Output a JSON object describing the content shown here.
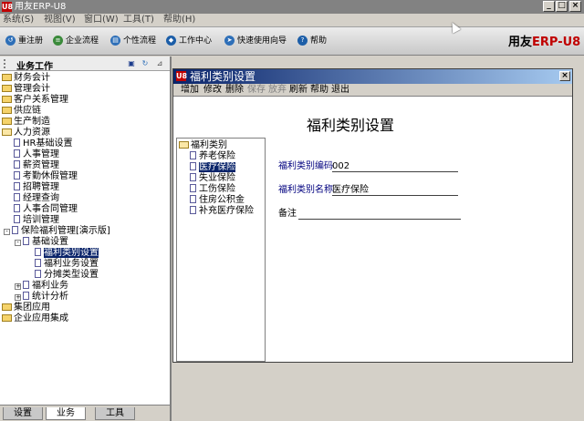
{
  "window": {
    "title": "用友ERP-U8",
    "logo_text": "U8",
    "buttons": {
      "minimize": "_",
      "maximize": "□",
      "close": "×"
    }
  },
  "menubar": {
    "items": [
      "系统(S)",
      "视图(V)",
      "窗口(W)",
      "工具(T)",
      "帮助(H)"
    ]
  },
  "toolbar": {
    "items": [
      {
        "label": "重注册",
        "icon": "re-register-icon"
      },
      {
        "label": "企业流程",
        "icon": "enterprise-flow-icon"
      },
      {
        "label": "个性流程",
        "icon": "personal-flow-icon"
      },
      {
        "label": "工作中心",
        "icon": "work-center-icon"
      },
      {
        "label": "快速使用向导",
        "icon": "quick-guide-icon"
      },
      {
        "label": "帮助",
        "icon": "help-icon"
      }
    ],
    "brand": {
      "cn": "用友",
      "en": "ERP-U8"
    }
  },
  "leftpane": {
    "title": "业务工作",
    "tree": [
      {
        "label": "财务会计",
        "kind": "folder",
        "level": 0
      },
      {
        "label": "管理会计",
        "kind": "folder",
        "level": 0
      },
      {
        "label": "客户关系管理",
        "kind": "folder",
        "level": 0
      },
      {
        "label": "供应链",
        "kind": "folder",
        "level": 0
      },
      {
        "label": "生产制造",
        "kind": "folder",
        "level": 0
      },
      {
        "label": "人力资源",
        "kind": "folder",
        "level": 0
      },
      {
        "label": "HR基础设置",
        "kind": "doc",
        "level": 1
      },
      {
        "label": "人事管理",
        "kind": "doc",
        "level": 1
      },
      {
        "label": "薪资管理",
        "kind": "doc",
        "level": 1
      },
      {
        "label": "考勤休假管理",
        "kind": "doc",
        "level": 1
      },
      {
        "label": "招聘管理",
        "kind": "doc",
        "level": 1
      },
      {
        "label": "经理查询",
        "kind": "doc",
        "level": 1
      },
      {
        "label": "人事合同管理",
        "kind": "doc",
        "level": 1
      },
      {
        "label": "培训管理",
        "kind": "doc",
        "level": 1
      },
      {
        "label": "保险福利管理[演示版]",
        "kind": "doc",
        "level": 1,
        "expander": "-"
      },
      {
        "label": "基础设置",
        "kind": "doc",
        "level": 2,
        "expander": "-"
      },
      {
        "label": "福利类别设置",
        "kind": "doc",
        "level": 3,
        "selected": true
      },
      {
        "label": "福利业务设置",
        "kind": "doc",
        "level": 3
      },
      {
        "label": "分摊类型设置",
        "kind": "doc",
        "level": 3
      },
      {
        "label": "福利业务",
        "kind": "doc",
        "level": 2,
        "expander": "+"
      },
      {
        "label": "统计分析",
        "kind": "doc",
        "level": 2,
        "expander": "+"
      },
      {
        "label": "集团应用",
        "kind": "folder",
        "level": 0
      },
      {
        "label": "企业应用集成",
        "kind": "folder",
        "level": 0
      }
    ],
    "tabs": [
      {
        "label": "设置",
        "active": false
      },
      {
        "label": "业务",
        "active": true
      },
      {
        "label": "工具",
        "active": false
      }
    ]
  },
  "child_window": {
    "title": "福利类别设置",
    "logo_text": "U8",
    "close": "×",
    "actions": [
      {
        "label": "增加",
        "enabled": true
      },
      {
        "label": "修改",
        "enabled": true
      },
      {
        "label": "删除",
        "enabled": true
      },
      {
        "label": "保存",
        "enabled": false
      },
      {
        "label": "放弃",
        "enabled": false
      },
      {
        "label": "刷新",
        "enabled": true
      },
      {
        "label": "帮助",
        "enabled": true
      },
      {
        "label": "退出",
        "enabled": true
      }
    ],
    "heading": "福利类别设置",
    "category_tree": {
      "root": "福利类别",
      "items": [
        {
          "label": "养老保险",
          "selected": false
        },
        {
          "label": "医疗保险",
          "selected": true
        },
        {
          "label": "失业保险",
          "selected": false
        },
        {
          "label": "工伤保险",
          "selected": false
        },
        {
          "label": "住房公积金",
          "selected": false
        },
        {
          "label": "补充医疗保险",
          "selected": false
        }
      ]
    },
    "form": {
      "code_label": "福利类别编码",
      "code_value": "002",
      "name_label": "福利类别名称",
      "name_value": "医疗保险",
      "note_label": "备注",
      "note_value": ""
    }
  }
}
